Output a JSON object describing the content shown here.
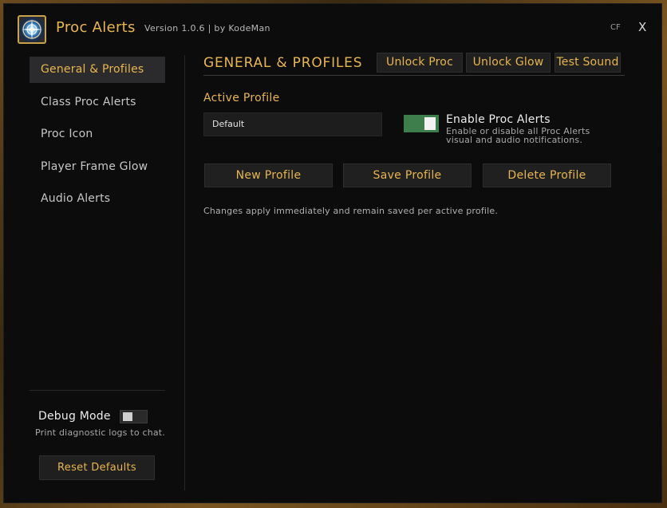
{
  "window": {
    "title": "Proc Alerts",
    "version": "Version 1.0.6  |  by KodeMan",
    "cf_label": "CF",
    "close_label": "X"
  },
  "sidebar": {
    "items": [
      {
        "label": "General & Profiles",
        "active": true
      },
      {
        "label": "Class Proc Alerts",
        "active": false
      },
      {
        "label": "Proc Icon",
        "active": false
      },
      {
        "label": "Player Frame Glow",
        "active": false
      },
      {
        "label": "Audio Alerts",
        "active": false
      }
    ],
    "debug": {
      "label": "Debug Mode",
      "enabled": false,
      "description": "Print diagnostic logs to chat."
    },
    "reset_label": "Reset Defaults"
  },
  "main": {
    "section_title": "GENERAL & PROFILES",
    "header_buttons": {
      "unlock_proc": "Unlock Proc",
      "unlock_glow": "Unlock Glow",
      "test_sound": "Test Sound"
    },
    "active_profile_label": "Active Profile",
    "active_profile_value": "Default",
    "enable": {
      "label": "Enable Proc Alerts",
      "enabled": true,
      "description_line1": "Enable or disable all Proc Alerts",
      "description_line2": "visual and audio notifications."
    },
    "actions": {
      "new_profile": "New Profile",
      "save_profile": "Save Profile",
      "delete_profile": "Delete Profile"
    },
    "note": "Changes apply immediately and remain saved per active profile."
  },
  "colors": {
    "accent": "#e8b64a",
    "toggle_on": "#3d7e4c",
    "panel_bg": "#0c0c0d",
    "active_nav_bg": "#2b2b2d"
  }
}
